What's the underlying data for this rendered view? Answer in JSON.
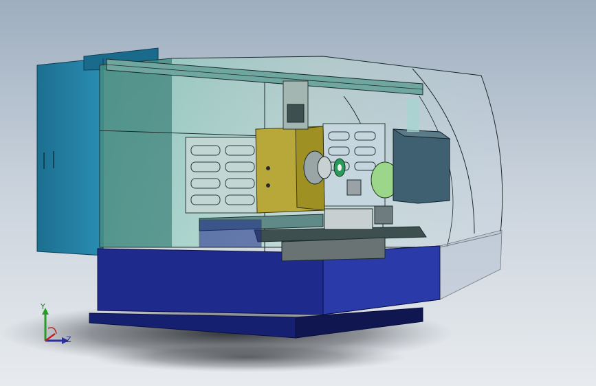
{
  "viewport": {
    "background_top": "#9eaebf",
    "background_bottom": "#e8ebee",
    "model_colors": {
      "base": "#1f2b8c",
      "base_dark": "#121a66",
      "side_panel": "#1b7aa0",
      "enclosure_glass": "#8fd2c4",
      "spindle_housing": "#b8a83a",
      "motor_block": "#3f6070",
      "chuck_green": "#9bd68a"
    }
  },
  "triad": {
    "y_label": "Y",
    "z_label": "Z",
    "y_color": "#2a9a2a",
    "z_color": "#2a2f9a",
    "x_color": "#c02020"
  }
}
